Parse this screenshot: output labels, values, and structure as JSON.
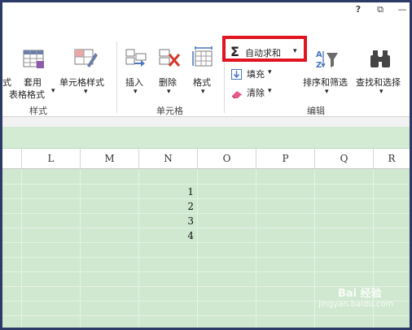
{
  "titlebar": {
    "help_label": "?",
    "restore_label": "⧉",
    "minimize_label": "—"
  },
  "ribbon": {
    "style_group": {
      "truncated_label": "式",
      "format_as_table_line1": "套用",
      "format_as_table_line2": "表格格式",
      "cell_styles_label": "单元格样式",
      "group_label": "样式"
    },
    "cells_group": {
      "insert_label": "插入",
      "delete_label": "删除",
      "format_label": "格式",
      "group_label": "单元格"
    },
    "editing_group": {
      "autosum_label": "自动求和",
      "fill_label": "填充",
      "clear_label": "清除",
      "sort_filter_label": "排序和筛选",
      "find_select_label": "查找和选择",
      "group_label": "编辑"
    },
    "dropdown_arrow": "▾"
  },
  "sheet": {
    "columns": [
      "L",
      "M",
      "N",
      "O",
      "P",
      "Q",
      "R"
    ],
    "values": [
      "1",
      "2",
      "3",
      "4"
    ]
  },
  "watermark": {
    "text": "Bai 经验",
    "url": "jingyan.baidu.com"
  },
  "colors": {
    "grid_bg": "#cfe8cf",
    "highlight_red": "#e0151f",
    "frame_border": "#2b3a67"
  }
}
